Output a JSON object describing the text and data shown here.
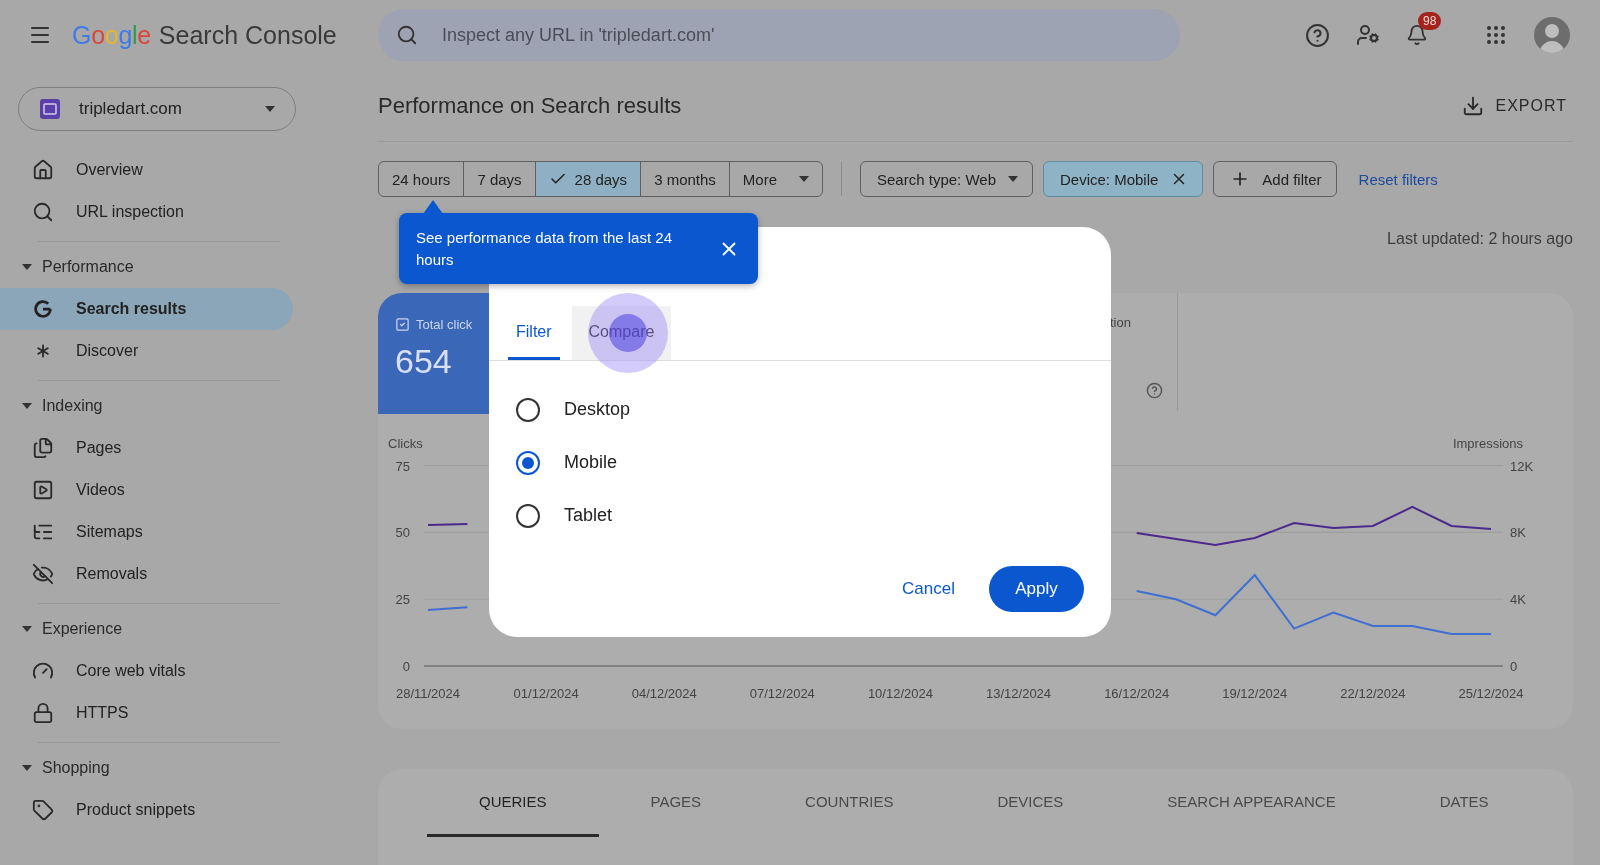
{
  "header": {
    "logo": "Google",
    "product": "Search Console",
    "search": {
      "placeholder": "Inspect any URL in 'tripledart.com'"
    },
    "notifications": {
      "badge": "98"
    }
  },
  "property": {
    "name": "tripledart.com"
  },
  "sidebar": [
    {
      "items": [
        {
          "label": "Overview",
          "selected": false
        },
        {
          "label": "URL inspection",
          "selected": false
        }
      ]
    },
    {
      "title": "Performance",
      "expanded": true,
      "items": [
        {
          "label": "Search results",
          "selected": true
        },
        {
          "label": "Discover",
          "selected": false
        }
      ]
    },
    {
      "title": "Indexing",
      "expanded": true,
      "items": [
        {
          "label": "Pages",
          "selected": false
        },
        {
          "label": "Videos",
          "selected": false
        },
        {
          "label": "Sitemaps",
          "selected": false
        },
        {
          "label": "Removals",
          "selected": false
        }
      ]
    },
    {
      "title": "Experience",
      "expanded": true,
      "items": [
        {
          "label": "Core web vitals",
          "selected": false
        },
        {
          "label": "HTTPS",
          "selected": false
        }
      ]
    },
    {
      "title": "Shopping",
      "expanded": true,
      "items": [
        {
          "label": "Product snippets",
          "selected": false
        }
      ]
    }
  ],
  "page": {
    "title": "Performance on Search results",
    "export": "EXPORT",
    "last_updated": "Last updated: 2 hours ago"
  },
  "date_ranges": [
    {
      "label": "24 hours",
      "selected": false
    },
    {
      "label": "7 days",
      "selected": false
    },
    {
      "label": "28 days",
      "selected": true
    },
    {
      "label": "3 months",
      "selected": false
    },
    {
      "label": "More",
      "selected": false,
      "kind": "menu"
    }
  ],
  "filters": [
    {
      "label": "Search type: Web",
      "kind": "dropdown",
      "active": false
    },
    {
      "label": "Device: Mobile",
      "kind": "removable",
      "active": true
    },
    {
      "label": "Add filter",
      "kind": "add",
      "active": false
    }
  ],
  "reset_filters": "Reset filters",
  "tooltip": {
    "text": "See performance data from the last 24 hours"
  },
  "metric_card": {
    "label": "Total click",
    "value": "654",
    "checked": true
  },
  "metric_fragment": {
    "label": "tion"
  },
  "chart": {
    "chart_data": {
      "type": "line",
      "ylabel": "Clicks",
      "y2label": "Impressions",
      "categories": [
        "28/11/2024",
        null,
        null,
        "01/12/2024",
        null,
        null,
        "04/12/2024",
        null,
        null,
        "07/12/2024",
        null,
        null,
        "10/12/2024",
        null,
        null,
        "13/12/2024",
        null,
        null,
        "16/12/2024",
        null,
        null,
        "19/12/2024",
        null,
        null,
        "22/12/2024",
        null,
        null,
        "25/12/2024"
      ],
      "series": [
        {
          "color": "#3f6fd0",
          "values": [
            21,
            22,
            null,
            null,
            null,
            null,
            null,
            null,
            null,
            null,
            null,
            null,
            null,
            null,
            null,
            null,
            null,
            null,
            28,
            25,
            19,
            34,
            14,
            20,
            15,
            15,
            12,
            12
          ]
        },
        {
          "color": "#4a2a8c",
          "axis": "y2",
          "values": [
            8440,
            8500,
            null,
            null,
            null,
            null,
            null,
            null,
            null,
            null,
            null,
            null,
            null,
            null,
            null,
            null,
            null,
            null,
            7960,
            7600,
            7240,
            7660,
            8560,
            8260,
            8380,
            9520,
            8380,
            8200
          ]
        }
      ],
      "ylim": [
        0,
        75
      ],
      "yticks": [
        0,
        25,
        50,
        75
      ],
      "y2lim": [
        0,
        12000
      ],
      "y2ticks": [
        {
          "value": 0,
          "label": "0"
        },
        {
          "value": 4000,
          "label": "4K"
        },
        {
          "value": 8000,
          "label": "8K"
        },
        {
          "value": 12000,
          "label": "12K"
        }
      ]
    }
  },
  "report_tabs": [
    {
      "label": "QUERIES",
      "selected": true
    },
    {
      "label": "PAGES",
      "selected": false
    },
    {
      "label": "COUNTRIES",
      "selected": false
    },
    {
      "label": "DEVICES",
      "selected": false
    },
    {
      "label": "SEARCH APPEARANCE",
      "selected": false
    },
    {
      "label": "DATES",
      "selected": false
    }
  ],
  "dialog": {
    "tabs": [
      {
        "label": "Filter",
        "selected": true
      },
      {
        "label": "Compare",
        "selected": false
      }
    ],
    "options": [
      {
        "label": "Desktop",
        "selected": false
      },
      {
        "label": "Mobile",
        "selected": true
      },
      {
        "label": "Tablet",
        "selected": false
      }
    ],
    "cancel": "Cancel",
    "apply": "Apply"
  }
}
